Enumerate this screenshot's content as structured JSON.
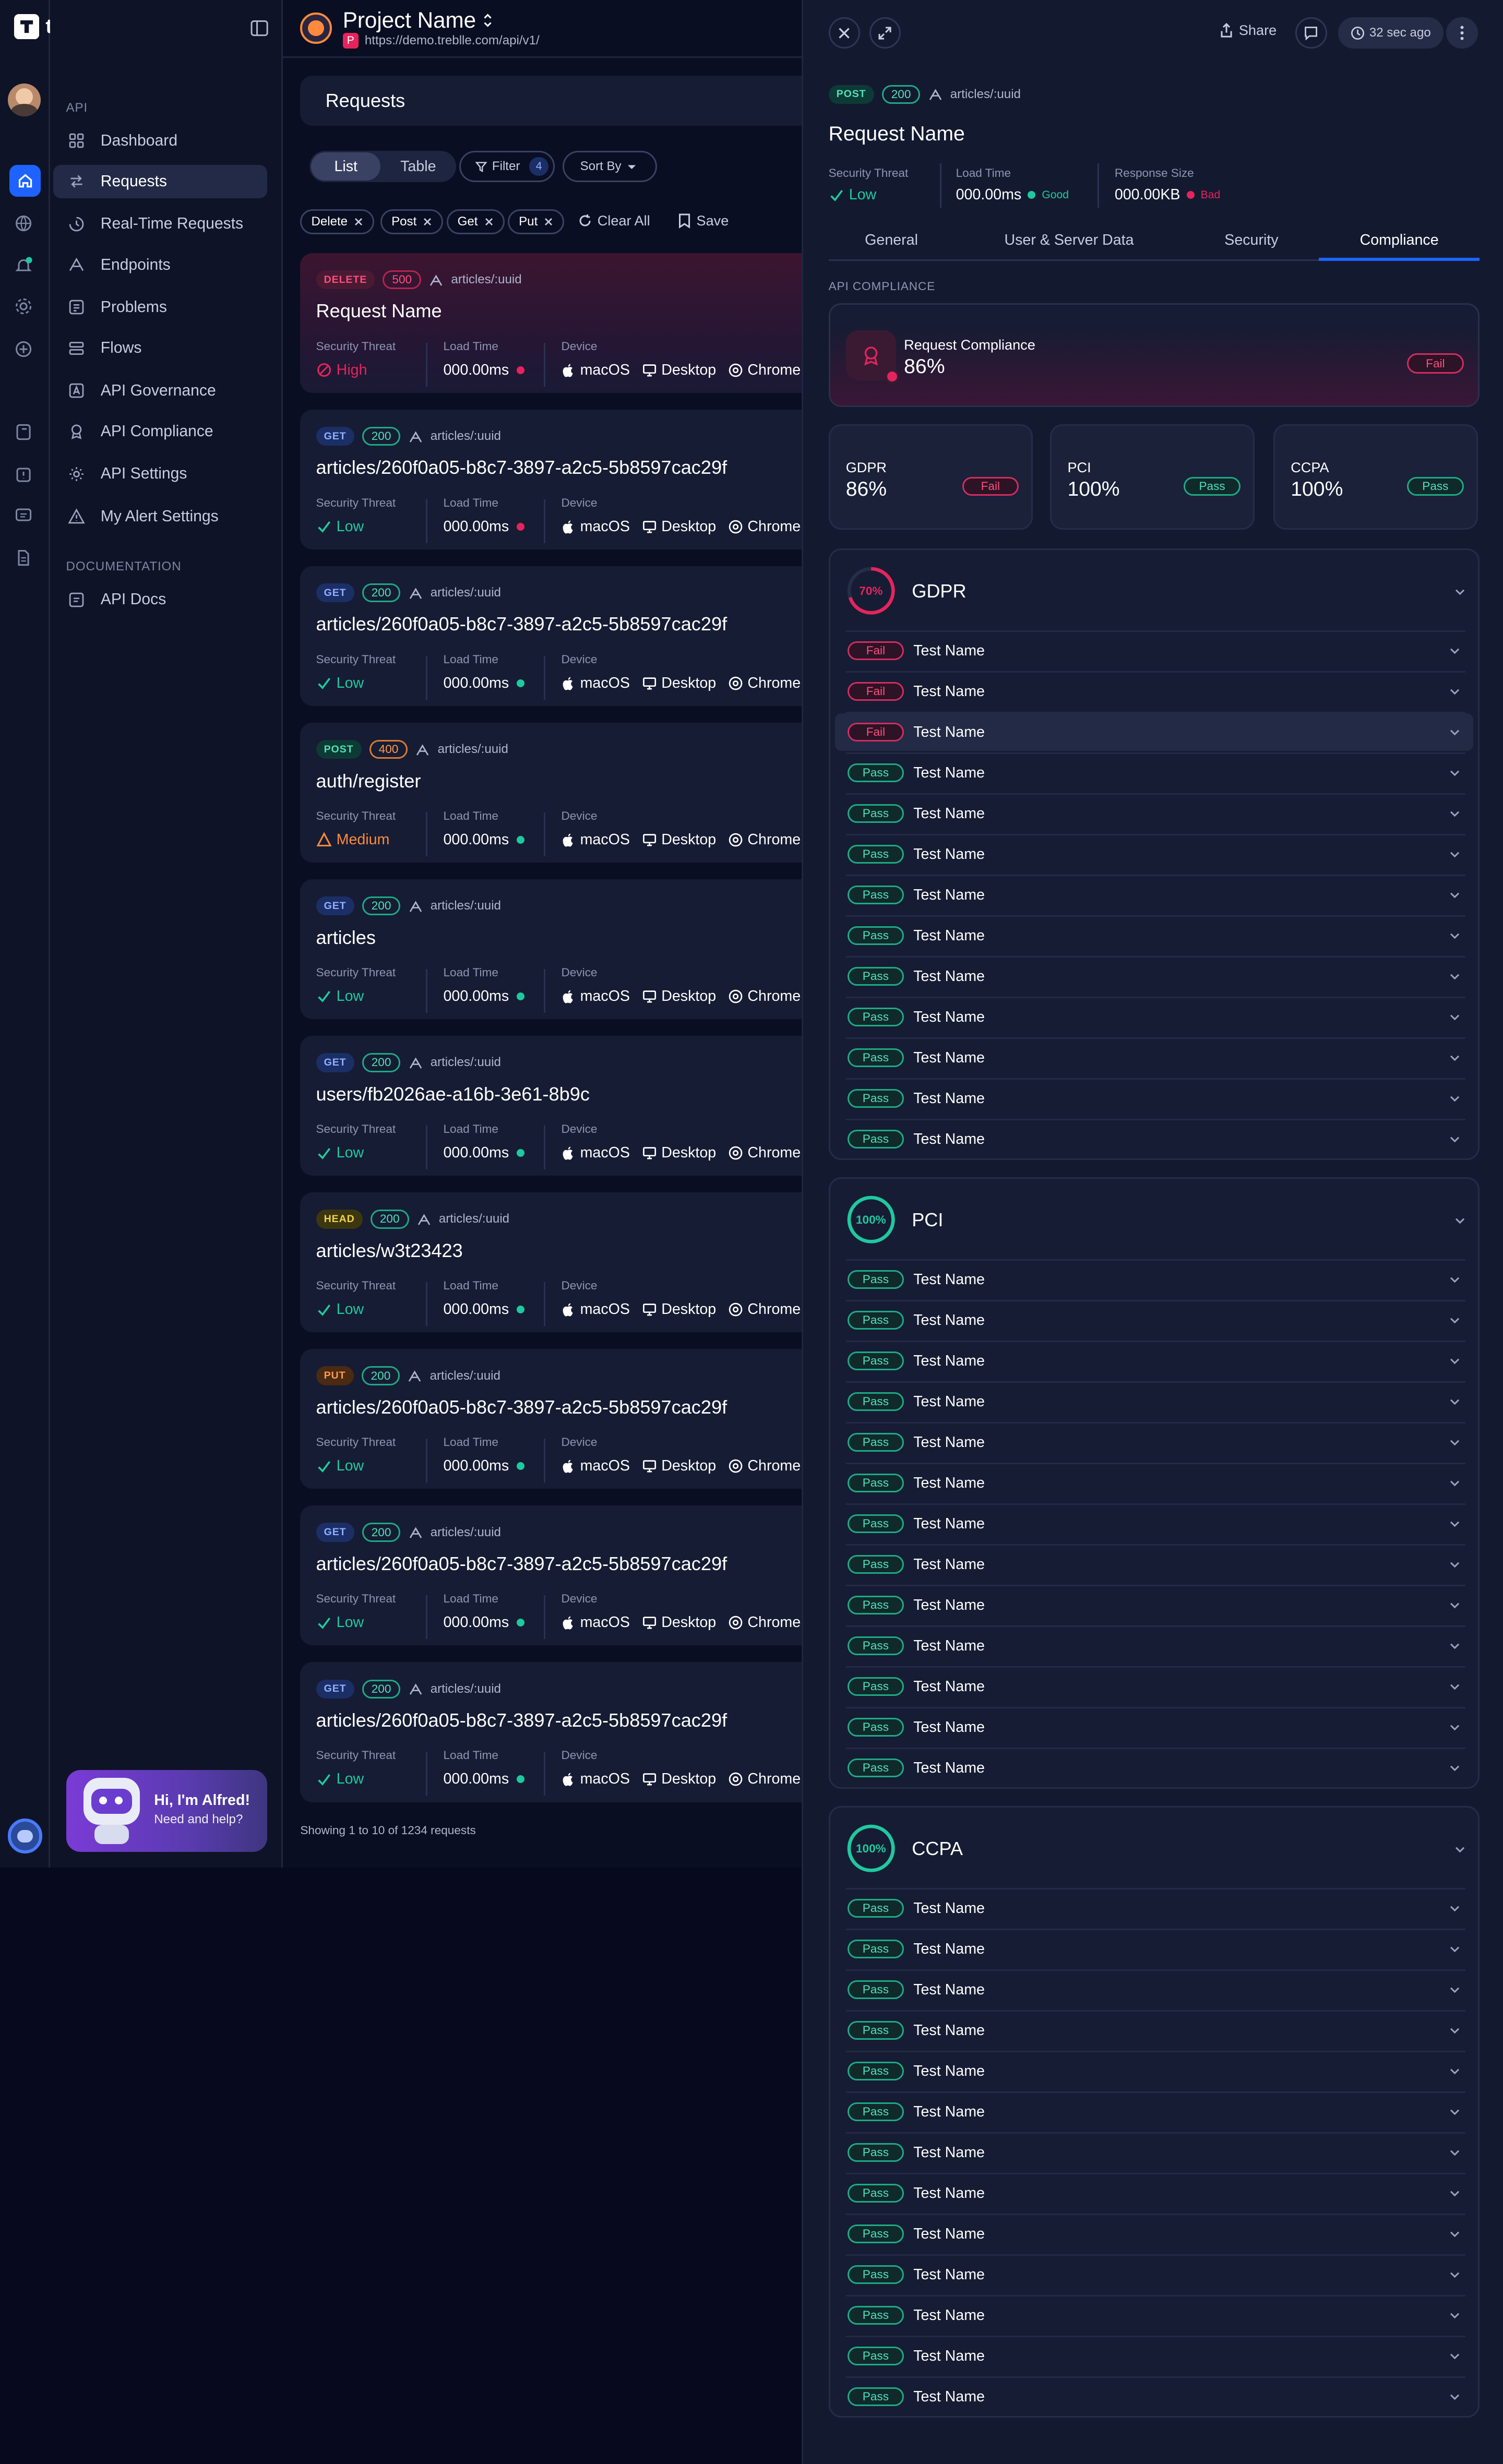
{
  "app": {
    "logo_text": "treblle"
  },
  "sidebar": {
    "api_section": "API",
    "items": [
      {
        "label": "Dashboard",
        "icon": "dashboard-icon"
      },
      {
        "label": "Requests",
        "icon": "requests-icon",
        "selected": true
      },
      {
        "label": "Real-Time Requests",
        "icon": "realtime-icon"
      },
      {
        "label": "Endpoints",
        "icon": "endpoints-icon"
      },
      {
        "label": "Problems",
        "icon": "problems-icon"
      },
      {
        "label": "Flows",
        "icon": "flows-icon"
      },
      {
        "label": "API Governance",
        "icon": "governance-icon"
      },
      {
        "label": "API Compliance",
        "icon": "compliance-icon"
      },
      {
        "label": "API Settings",
        "icon": "gear-icon"
      },
      {
        "label": "My Alert Settings",
        "icon": "alert-icon"
      }
    ],
    "doc_section": "DOCUMENTATION",
    "doc_items": [
      {
        "label": "API Docs",
        "icon": "docs-icon"
      }
    ],
    "alfred": {
      "title": "Hi, I'm Alfred!",
      "subtitle": "Need and help?"
    }
  },
  "project": {
    "name": "Project Name",
    "url": "https://demo.treblle.com/api/v1/",
    "badge": "P"
  },
  "requests": {
    "title": "Requests",
    "view_tabs": [
      "List",
      "Table"
    ],
    "filter_label": "Filter",
    "filter_count": "4",
    "sort_label": "Sort By",
    "chips": [
      "Delete",
      "Post",
      "Get",
      "Put"
    ],
    "clear_all": "Clear All",
    "save": "Save",
    "labels": {
      "threat": "Security Threat",
      "load": "Load Time",
      "device": "Device"
    },
    "device": {
      "os": "macOS",
      "type": "Desktop",
      "browser": "Chrome"
    },
    "items": [
      {
        "method": "DELETE",
        "code": "500",
        "path": "articles/:uuid",
        "name": "Request Name",
        "threat": "High",
        "load": "000.00ms",
        "load_status": "bad"
      },
      {
        "method": "GET",
        "code": "200",
        "path": "articles/:uuid",
        "name": "articles/260f0a05-b8c7-3897-a2c5-5b8597cac29f",
        "threat": "Low",
        "load": "000.00ms",
        "load_status": "bad"
      },
      {
        "method": "GET",
        "code": "200",
        "path": "articles/:uuid",
        "name": "articles/260f0a05-b8c7-3897-a2c5-5b8597cac29f",
        "threat": "Low",
        "load": "000.00ms",
        "load_status": "good"
      },
      {
        "method": "POST",
        "code": "400",
        "path": "articles/:uuid",
        "name": "auth/register",
        "threat": "Medium",
        "load": "000.00ms",
        "load_status": "good"
      },
      {
        "method": "GET",
        "code": "200",
        "path": "articles/:uuid",
        "name": "articles",
        "threat": "Low",
        "load": "000.00ms",
        "load_status": "good"
      },
      {
        "method": "GET",
        "code": "200",
        "path": "articles/:uuid",
        "name": "users/fb2026ae-a16b-3e61-8b9c",
        "threat": "Low",
        "load": "000.00ms",
        "load_status": "good"
      },
      {
        "method": "HEAD",
        "code": "200",
        "path": "articles/:uuid",
        "name": "articles/w3t23423",
        "threat": "Low",
        "load": "000.00ms",
        "load_status": "good"
      },
      {
        "method": "PUT",
        "code": "200",
        "path": "articles/:uuid",
        "name": "articles/260f0a05-b8c7-3897-a2c5-5b8597cac29f",
        "threat": "Low",
        "load": "000.00ms",
        "load_status": "good"
      },
      {
        "method": "GET",
        "code": "200",
        "path": "articles/:uuid",
        "name": "articles/260f0a05-b8c7-3897-a2c5-5b8597cac29f",
        "threat": "Low",
        "load": "000.00ms",
        "load_status": "good"
      },
      {
        "method": "GET",
        "code": "200",
        "path": "articles/:uuid",
        "name": "articles/260f0a05-b8c7-3897-a2c5-5b8597cac29f",
        "threat": "Low",
        "load": "000.00ms",
        "load_status": "good"
      }
    ],
    "footer": "Showing 1 to 10 of 1234 requests"
  },
  "detail": {
    "share": "Share",
    "time_ago": "32 sec ago",
    "method": "POST",
    "code": "200",
    "path": "articles/:uuid",
    "name": "Request Name",
    "stats": {
      "threat_label": "Security Threat",
      "threat": "Low",
      "load_label": "Load Time",
      "load": "000.00ms",
      "load_status": "Good",
      "size_label": "Response Size",
      "size": "000.00KB",
      "size_status": "Bad"
    },
    "tabs": [
      "General",
      "User & Server Data",
      "Security",
      "Compliance"
    ],
    "active_tab": "Compliance",
    "compliance_heading": "API COMPLIANCE",
    "request_compliance": {
      "label": "Request Compliance",
      "value": "86%",
      "status": "Fail"
    },
    "summary": [
      {
        "name": "GDPR",
        "value": "86%",
        "status": "Fail"
      },
      {
        "name": "PCI",
        "value": "100%",
        "status": "Pass"
      },
      {
        "name": "CCPA",
        "value": "100%",
        "status": "Pass"
      }
    ],
    "sections": [
      {
        "name": "GDPR",
        "percent": "70%",
        "percent_value": 0.7,
        "color": "#e5245d",
        "tests": [
          {
            "status": "Fail",
            "name": "Test Name"
          },
          {
            "status": "Fail",
            "name": "Test Name"
          },
          {
            "status": "Fail",
            "name": "Test Name"
          },
          {
            "status": "Pass",
            "name": "Test Name"
          },
          {
            "status": "Pass",
            "name": "Test Name"
          },
          {
            "status": "Pass",
            "name": "Test Name"
          },
          {
            "status": "Pass",
            "name": "Test Name"
          },
          {
            "status": "Pass",
            "name": "Test Name"
          },
          {
            "status": "Pass",
            "name": "Test Name"
          },
          {
            "status": "Pass",
            "name": "Test Name"
          },
          {
            "status": "Pass",
            "name": "Test Name"
          },
          {
            "status": "Pass",
            "name": "Test Name"
          },
          {
            "status": "Pass",
            "name": "Test Name"
          }
        ]
      },
      {
        "name": "PCI",
        "percent": "100%",
        "percent_value": 1.0,
        "color": "#1fc9a0",
        "tests": [
          {
            "status": "Pass",
            "name": "Test Name"
          },
          {
            "status": "Pass",
            "name": "Test Name"
          },
          {
            "status": "Pass",
            "name": "Test Name"
          },
          {
            "status": "Pass",
            "name": "Test Name"
          },
          {
            "status": "Pass",
            "name": "Test Name"
          },
          {
            "status": "Pass",
            "name": "Test Name"
          },
          {
            "status": "Pass",
            "name": "Test Name"
          },
          {
            "status": "Pass",
            "name": "Test Name"
          },
          {
            "status": "Pass",
            "name": "Test Name"
          },
          {
            "status": "Pass",
            "name": "Test Name"
          },
          {
            "status": "Pass",
            "name": "Test Name"
          },
          {
            "status": "Pass",
            "name": "Test Name"
          },
          {
            "status": "Pass",
            "name": "Test Name"
          }
        ]
      },
      {
        "name": "CCPA",
        "percent": "100%",
        "percent_value": 1.0,
        "color": "#1fc9a0",
        "tests": [
          {
            "status": "Pass",
            "name": "Test Name"
          },
          {
            "status": "Pass",
            "name": "Test Name"
          },
          {
            "status": "Pass",
            "name": "Test Name"
          },
          {
            "status": "Pass",
            "name": "Test Name"
          },
          {
            "status": "Pass",
            "name": "Test Name"
          },
          {
            "status": "Pass",
            "name": "Test Name"
          },
          {
            "status": "Pass",
            "name": "Test Name"
          },
          {
            "status": "Pass",
            "name": "Test Name"
          },
          {
            "status": "Pass",
            "name": "Test Name"
          },
          {
            "status": "Pass",
            "name": "Test Name"
          },
          {
            "status": "Pass",
            "name": "Test Name"
          },
          {
            "status": "Pass",
            "name": "Test Name"
          },
          {
            "status": "Pass",
            "name": "Test Name"
          }
        ]
      }
    ]
  },
  "colors": {
    "accent": "#1e63ff",
    "good": "#1fc9a0",
    "bad": "#e5245d",
    "medium": "#ff8a3d"
  }
}
